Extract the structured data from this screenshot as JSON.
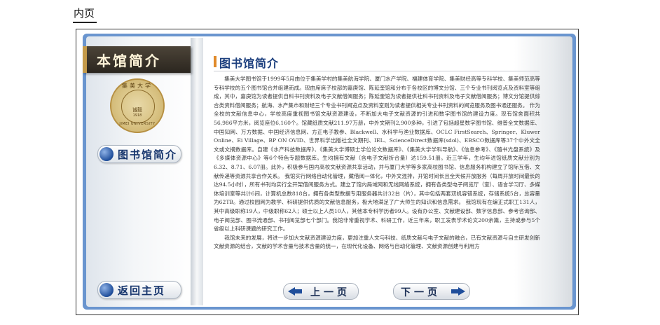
{
  "page_label": "内页",
  "banner": {
    "title": "本馆简介"
  },
  "seal": {
    "top_text": "集美大学",
    "middle_text": "诚毅",
    "year": "1918",
    "bottom_text": "JIMEI UNIVERSITY"
  },
  "sidebar": {
    "intro_button": "图书馆简介"
  },
  "content": {
    "title": "图书馆简介",
    "paragraphs": [
      "集美大学图书馆于1999年5月由位于集美学村的集美航海学院、厦门水产学院、福建体育学院、集美财经高等专科学校、集美师范高等专科学校的五个图书馆合并组建而成。现由席席子校部的嘉庚馆、陈延奎馆和分布于各校区的博文分馆、三个专业书刊阅览点及资料室等组成，其中，嘉庚馆为读者提供自科书刊资料及电子文献借阅服务；陈延奎馆为读者提供社科书刊资料及电子文献借阅服务；博文分馆提供综合类资料借阅服务；航海、水产集市和财经三个专业书刊阅览点及资料室则为读者提供相关专业书刊资料的阅览服务及图书通还服务。  作为全校的文献信息中心，学校高度重视图书馆文献资源建设，不断加大电子文献资源的引进和数字图书馆的建设力度。现有馆舍面积共56,986平方米，阅览座位6,160个。馆藏纸质文献211.97万册，中外文期刊2,900多种，引进了包括超星数字图书馆、维普全文数据库、中国知网、万方数据、中国经济信息网、方正电子教参、Blackwell、水科学与渔业数据库、OCLC FirstSearch、Springer、Kluwer Online、Ei Village、BP ON OVID、世界科学出版社全文期刊、IEL、ScienceDirect数据库(sdol)、EBSCO数据库等37个中外文全文或文摘数据库。自建《水产科技数据库》、《集美大学博硕士学位论文数据库》、《集美大学学科导航》、《信息参考》、《随书光盘系统》及《多媒体资源中心》等6个特色专题数据库。生均拥有文献（含电子文献折合量）达159.51册。近三学年，生均年进馆纸质文献分别为6.32、8.71、6.07册。此外，积极参与国内高校文献资源共享活动，并与厦门大学等多家高校图书馆、信息服务机构建立了馆际互借、文献传递等资源共享合作关系。  我馆实行网络自动化管理，藏借阅一体化，中外文混排，开馆时间长且全天候开放服务（每周开放时间最长的达94.5小时），所有书刊均实行全开架借阅服务方式。建立了馆内局域网和无线网络系统，拥有各类型电子阅览厅（室）、语言学习厅、多媒体培训室等共计6间，计算机总数818台，拥有各类型数据专用服务器共计32台（片），其中包括两套双机容错系统，存储系统5台，总容量为62TB。通过校园网为教学、科研提供优质的文献信息服务，极大地满足了广大师生的知识和信息需求。  我馆现有在编正式职工131人，其中高级职称19人，中级职称62人；硕士以上人员10人，其他本专科学历者99人。设有办公室、文献建设部、数字信息部、参考咨询部、电子阅览部、图书流通部、书刊阅览部七个部门。我馆非常重视学术、科研工作，近三年来，职工发表学术论文200余篇，主持或参与5个省级以上科研课题的研究工作。",
      "我馆未来的发展，将进一步加大文献资源建设力度，更加注重人文与科技、纸质文献与电子文献的融合，已有文献资源与自主研发创新文献资源的结合，文献的学术含量与技术含量的统一，在现代化设备、网络与自动化管理、文献资源创建与利用方"
    ]
  },
  "nav": {
    "home_button": "返回主页",
    "prev_button": "上一页",
    "next_button": "下一页"
  }
}
